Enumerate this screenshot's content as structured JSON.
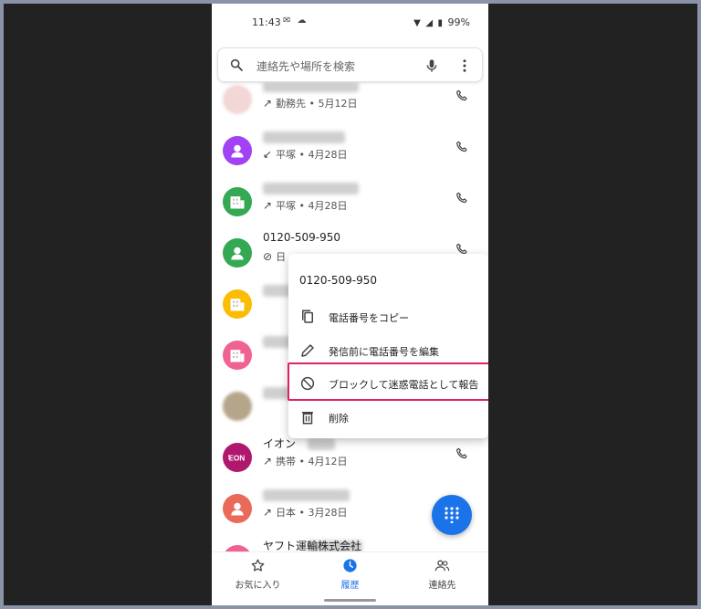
{
  "status": {
    "time": "11:43",
    "left_icons": "✉ ☁",
    "battery": "99%"
  },
  "search": {
    "placeholder": "連絡先や場所を検索"
  },
  "calls": [
    {
      "name": "",
      "arrow": "↗",
      "detail": "勤務先 • 5月12日",
      "avatar_color": "#f3d6d6",
      "avatar_icon": "photo"
    },
    {
      "name": "",
      "arrow": "↙",
      "detail": "平塚 • 4月28日",
      "avatar_color": "#a142f4",
      "avatar_icon": "person"
    },
    {
      "name": "",
      "arrow": "↗",
      "detail": "平塚 • 4月28日",
      "avatar_color": "#34a853",
      "avatar_icon": "building"
    },
    {
      "name": "0120-509-950",
      "arrow": "⊘",
      "detail": "日",
      "avatar_color": "#34a853",
      "avatar_icon": "person"
    },
    {
      "name": "",
      "arrow": "",
      "detail": "",
      "avatar_color": "#fbbc04",
      "avatar_icon": "building"
    },
    {
      "name": "",
      "arrow": "",
      "detail": "",
      "avatar_color": "#f06292",
      "avatar_icon": "building"
    },
    {
      "name": "",
      "arrow": "",
      "detail": "",
      "avatar_color": "#b5a58a",
      "avatar_icon": "photo"
    },
    {
      "name": "イオン",
      "arrow": "↗",
      "detail": "携帯 • 4月12日",
      "avatar_color": "#b0186e",
      "avatar_icon": "aeon"
    },
    {
      "name": "",
      "arrow": "↗",
      "detail": "日本 • 3月28日",
      "avatar_color": "#ea6a5a",
      "avatar_icon": "person"
    },
    {
      "name": "ヤフト運輸株式会社",
      "arrow": "",
      "detail": "",
      "avatar_color": "#f06292",
      "avatar_icon": "person"
    }
  ],
  "menu": {
    "title": "0120-509-950",
    "items": [
      {
        "label": "電話番号をコピー",
        "icon": "copy-icon"
      },
      {
        "label": "発信前に電話番号を編集",
        "icon": "edit-icon"
      },
      {
        "label": "ブロックして迷惑電話として報告",
        "icon": "block-icon"
      },
      {
        "label": "削除",
        "icon": "delete-icon"
      }
    ]
  },
  "nav": {
    "favorites": "お気に入り",
    "history": "履歴",
    "contacts": "連絡先"
  },
  "colors": {
    "accent": "#1a73e8",
    "highlight": "#e0245e"
  }
}
